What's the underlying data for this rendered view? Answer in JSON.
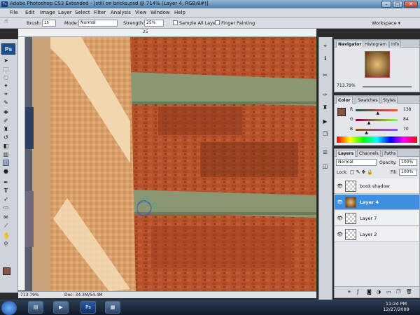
{
  "app": {
    "title": "Adobe Photoshop CS3 Extended - [still on bricks.psd @ 714% (Layer 4, RGB/8#)]",
    "ps_logo": "Ps"
  },
  "window_controls": {
    "minimize": "–",
    "maximize": "□",
    "close": "✕"
  },
  "menu": {
    "items": [
      "File",
      "Edit",
      "Image",
      "Layer",
      "Select",
      "Filter",
      "Analysis",
      "View",
      "Window",
      "Help"
    ]
  },
  "options": {
    "brush_label": "Brush:",
    "brush_size": "15",
    "mode_label": "Mode:",
    "mode_value": "Normal",
    "strength_label": "Strength:",
    "strength_value": "25%",
    "sample_all_layers": "Sample All Layers",
    "finger_painting": "Finger Painting",
    "workspace": "Workspace ▾"
  },
  "ruler": {
    "tick_25": "25"
  },
  "status": {
    "zoom": "713.79%",
    "doc": "Doc: 34.3M/54.4M"
  },
  "navigator": {
    "tabs": [
      "Navigator",
      "Histogram",
      "Info"
    ],
    "zoom": "713.79%"
  },
  "color": {
    "tabs": [
      "Color",
      "Swatches",
      "Styles"
    ],
    "r_label": "R",
    "r_value": "138",
    "g_label": "G",
    "g_value": "84",
    "b_label": "B",
    "b_value": "70",
    "r_level": 0.54,
    "g_level": 0.33,
    "b_level": 0.27,
    "swatch": "#8a5446"
  },
  "layers": {
    "tabs": [
      "Layers",
      "Channels",
      "Paths"
    ],
    "blend_mode": "Normal",
    "opacity_label": "Opacity:",
    "opacity_value": "100%",
    "lock_label": "Lock:",
    "fill_label": "Fill:",
    "fill_value": "100%",
    "items": [
      "book shadow",
      "Layer 4",
      "Layer 7",
      "Layer 2"
    ],
    "selected": "Layer 4"
  },
  "taskbar": {
    "ps_button": "Ps",
    "time": "11:24 PM",
    "date": "12/27/2009"
  },
  "colors": {
    "accent": "#3f8fe0",
    "brick": "#b6512b",
    "mortar": "#8a9772"
  }
}
